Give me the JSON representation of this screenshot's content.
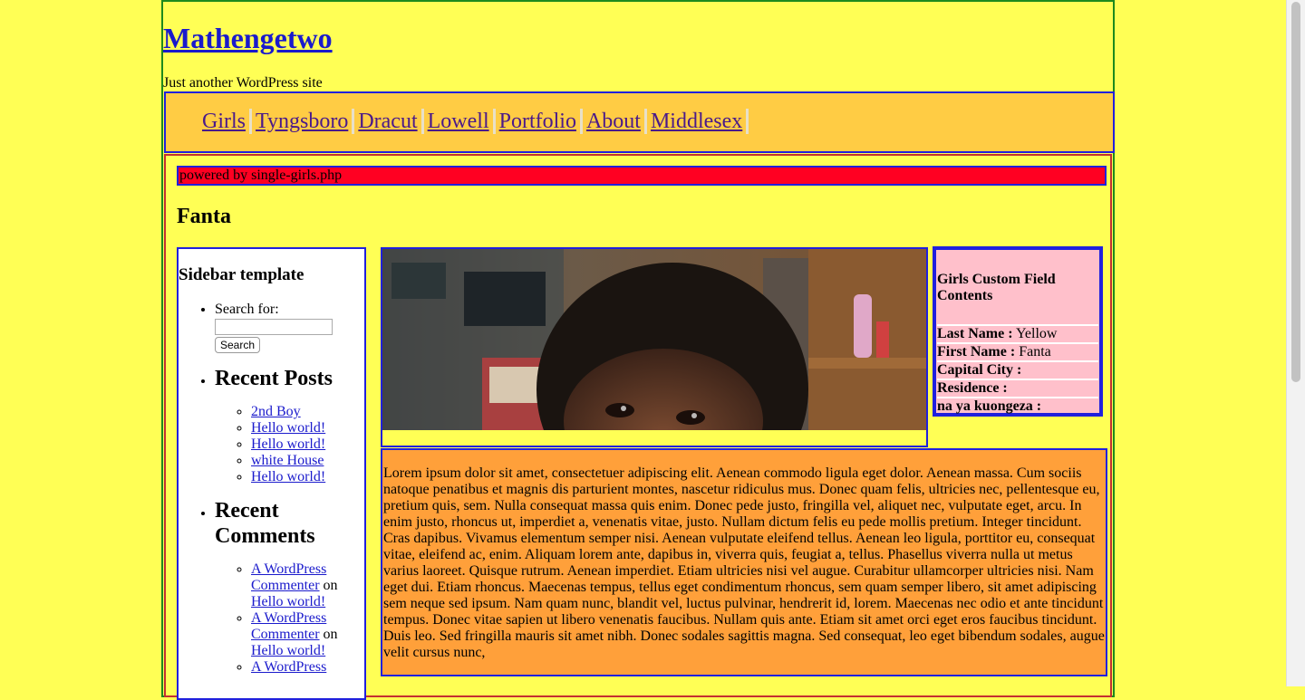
{
  "site": {
    "title": "Mathengetwo",
    "tagline": "Just another WordPress site"
  },
  "nav": {
    "items": [
      {
        "label": "Girls"
      },
      {
        "label": "Tyngsboro"
      },
      {
        "label": "Dracut"
      },
      {
        "label": "Lowell"
      },
      {
        "label": "Portfolio"
      },
      {
        "label": "About"
      },
      {
        "label": "Middlesex"
      }
    ]
  },
  "powered_by": "powered by single-girls.php",
  "post": {
    "title": "Fanta",
    "body": "Lorem ipsum dolor sit amet, consectetuer adipiscing elit. Aenean commodo ligula eget dolor. Aenean massa. Cum sociis natoque penatibus et magnis dis parturient montes, nascetur ridiculus mus. Donec quam felis, ultricies nec, pellentesque eu, pretium quis, sem. Nulla consequat massa quis enim. Donec pede justo, fringilla vel, aliquet nec, vulputate eget, arcu. In enim justo, rhoncus ut, imperdiet a, venenatis vitae, justo. Nullam dictum felis eu pede mollis pretium. Integer tincidunt. Cras dapibus. Vivamus elementum semper nisi. Aenean vulputate eleifend tellus. Aenean leo ligula, porttitor eu, consequat vitae, eleifend ac, enim. Aliquam lorem ante, dapibus in, viverra quis, feugiat a, tellus. Phasellus viverra nulla ut metus varius laoreet. Quisque rutrum. Aenean imperdiet. Etiam ultricies nisi vel augue. Curabitur ullamcorper ultricies nisi. Nam eget dui. Etiam rhoncus. Maecenas tempus, tellus eget condimentum rhoncus, sem quam semper libero, sit amet adipiscing sem neque sed ipsum. Nam quam nunc, blandit vel, luctus pulvinar, hendrerit id, lorem. Maecenas nec odio et ante tincidunt tempus. Donec vitae sapien ut libero venenatis faucibus. Nullam quis ante. Etiam sit amet orci eget eros faucibus tincidunt. Duis leo. Sed fringilla mauris sit amet nibh. Donec sodales sagittis magna. Sed consequat, leo eget bibendum sodales, augue velit cursus nunc,"
  },
  "custom_fields": {
    "title": "Girls Custom Field Contents",
    "rows": [
      {
        "label": "Last Name :",
        "value": " Yellow"
      },
      {
        "label": "First Name :",
        "value": " Fanta"
      },
      {
        "label": "Capital City :",
        "value": ""
      },
      {
        "label": "Residence :",
        "value": ""
      },
      {
        "label": "na ya kuongeza :",
        "value": ""
      }
    ]
  },
  "sidebar": {
    "heading": "Sidebar template",
    "search_label": "Search for:",
    "search_value": "",
    "search_button": "Search",
    "recent_posts": {
      "heading": "Recent Posts",
      "items": [
        "2nd Boy",
        "Hello world!",
        "Hello world!",
        "white House",
        "Hello world!"
      ]
    },
    "recent_comments": {
      "heading": "Recent Comments",
      "items": [
        {
          "author": "A WordPress Commenter",
          "on": " on ",
          "post": "Hello world!"
        },
        {
          "author": "A WordPress Commenter",
          "on": " on ",
          "post": "Hello world!"
        },
        {
          "author": "A WordPress",
          "on": "",
          "post": ""
        }
      ]
    }
  },
  "colors": {
    "page_bg": "#ffff55",
    "nav_bg": "#ffcc44",
    "powered_bg": "#ff0022",
    "custom_bg": "#ffc0cb",
    "lorem_bg": "#ffa03a",
    "border_blue": "#2020dd",
    "link": "#1a1acc"
  }
}
